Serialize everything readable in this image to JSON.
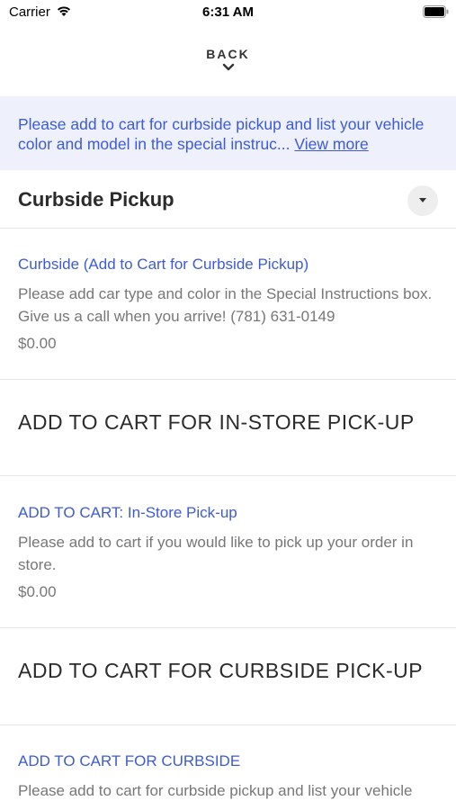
{
  "status_bar": {
    "carrier": "Carrier",
    "time": "6:31 AM"
  },
  "nav": {
    "back_label": "BACK"
  },
  "banner": {
    "text": "Please add to cart for curbside pickup and list your vehicle color and model in the special instruc...",
    "link": "View more"
  },
  "section": {
    "title": "Curbside Pickup"
  },
  "items": [
    {
      "title": "Curbside (Add to Cart for Curbside Pickup)",
      "desc": "Please add car type and color in the Special Instructions box. Give us a call when you arrive! (781) 631-0149",
      "price": "$0.00"
    },
    {
      "title": "ADD TO CART: In-Store Pick-up",
      "desc": "Please add to cart if you would like to pick up your order in store.",
      "price": "$0.00"
    },
    {
      "title": "ADD TO CART FOR CURBSIDE",
      "desc": "Please add to cart for curbside pickup and list your vehicle"
    }
  ],
  "headings": [
    "ADD TO CART FOR IN-STORE PICK-UP",
    "ADD TO CART FOR CURBSIDE PICK-UP"
  ],
  "colors": {
    "accent": "#3d5bd6",
    "banner_bg": "#eef1fc",
    "muted_text": "#777777"
  }
}
